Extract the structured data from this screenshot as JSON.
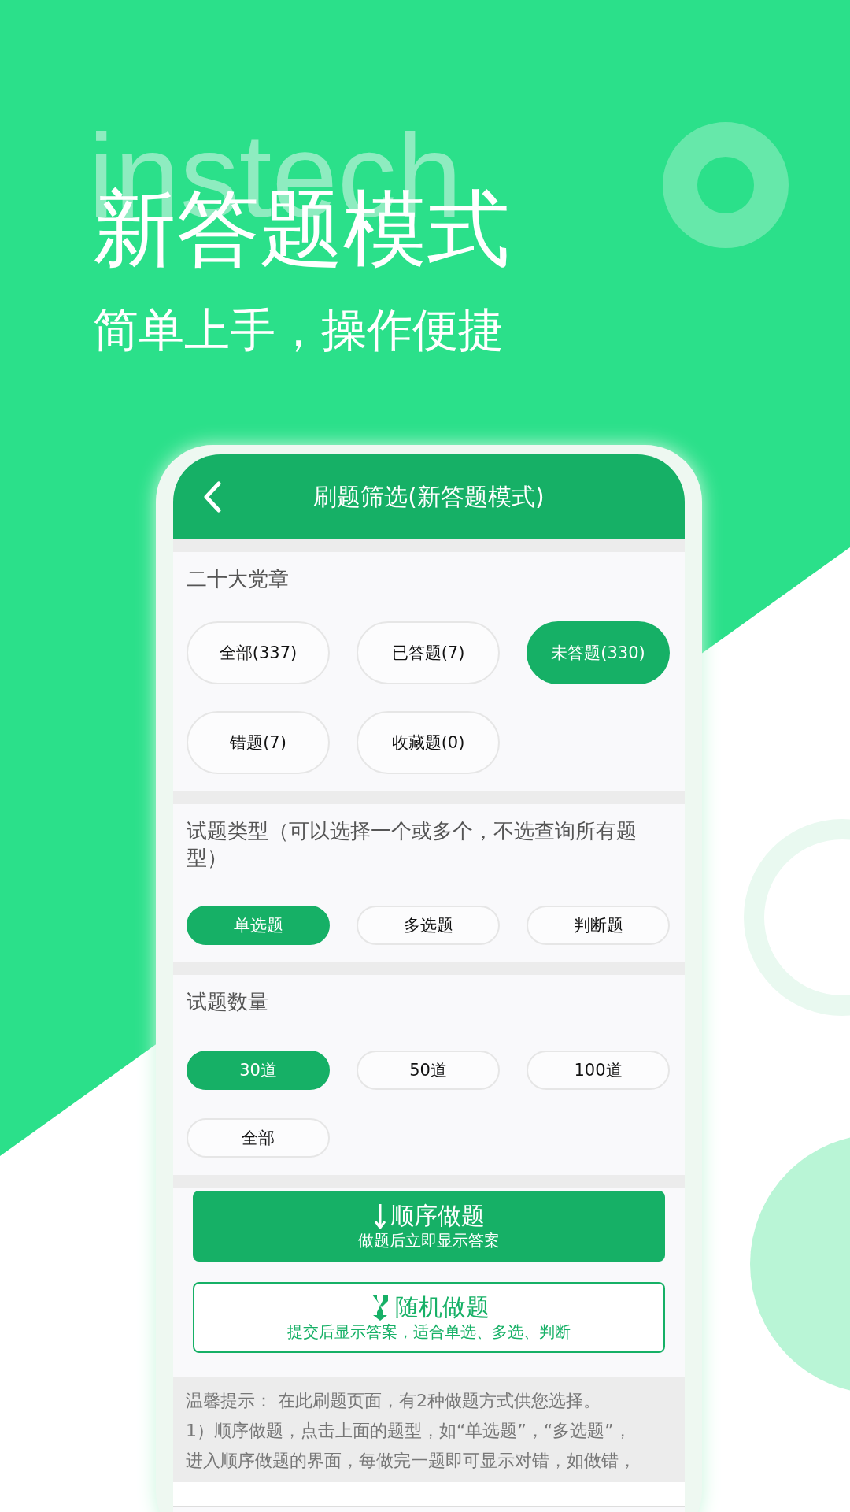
{
  "hero": {
    "backdrop_text": "instech",
    "title": "新答题模式",
    "subtitle": "简单上手，操作便捷"
  },
  "phone": {
    "header": {
      "title": "刷题筛选(新答题模式)"
    },
    "sections": [
      {
        "label": "二十大党章",
        "kind": "large",
        "options": [
          {
            "label": "全部(337)",
            "selected": false
          },
          {
            "label": "已答题(7)",
            "selected": false
          },
          {
            "label": "未答题(330)",
            "selected": true
          },
          {
            "label": "错题(7)",
            "selected": false
          },
          {
            "label": "收藏题(0)",
            "selected": false
          }
        ]
      },
      {
        "label": "试题类型（可以选择一个或多个，不选查询所有题型）",
        "kind": "small",
        "options": [
          {
            "label": "单选题",
            "selected": true
          },
          {
            "label": "多选题",
            "selected": false
          },
          {
            "label": "判断题",
            "selected": false
          }
        ]
      },
      {
        "label": "试题数量",
        "kind": "small",
        "options": [
          {
            "label": "30道",
            "selected": true
          },
          {
            "label": "50道",
            "selected": false
          },
          {
            "label": "100道",
            "selected": false
          },
          {
            "label": "全部",
            "selected": false
          }
        ]
      }
    ],
    "actions": [
      {
        "kind": "sequential",
        "title": "顺序做题",
        "subtitle": "做题后立即显示答案"
      },
      {
        "kind": "random",
        "title": "随机做题",
        "subtitle": "提交后显示答案，适合单选、多选、判断"
      }
    ],
    "tips": [
      "温馨提示：  在此刷题页面，有2种做题方式供您选择。",
      "1）顺序做题，点击上面的题型，如“单选题”，“多选题”，",
      "进入顺序做题的界面，每做完一题即可显示对错，如做错，"
    ]
  }
}
